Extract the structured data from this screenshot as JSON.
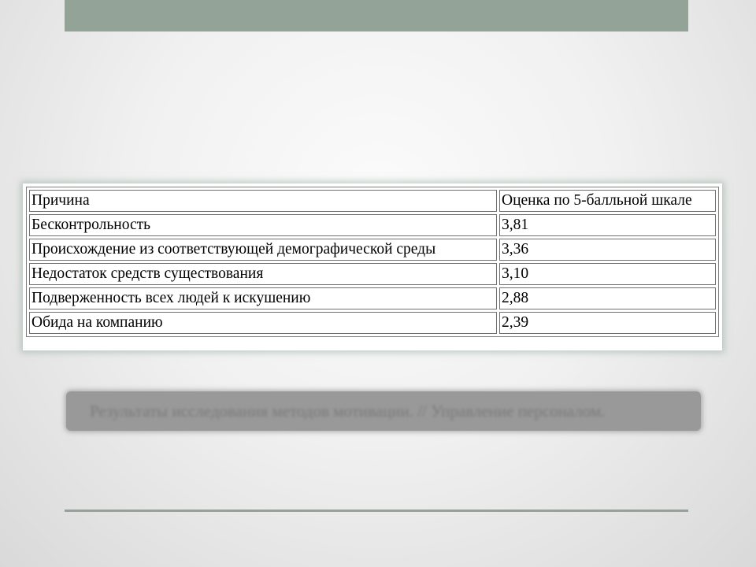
{
  "slide": {
    "table": {
      "header": {
        "reason": "Причина",
        "score": "Оценка по 5-балльной шкале"
      },
      "rows": [
        {
          "reason": "Бесконтрольность",
          "score": "3,81"
        },
        {
          "reason": "Происхождение из соответствующей демографической среды",
          "score": "3,36"
        },
        {
          "reason": "Недостаток средств существования",
          "score": "3,10"
        },
        {
          "reason": "Подверженность всех людей к искушению",
          "score": "2,88"
        },
        {
          "reason": "Обида на компанию",
          "score": "2,39"
        }
      ]
    },
    "caption": "Результаты исследования методов мотивации. // Управление персоналом.",
    "colors": {
      "accent_bar": "#93a398",
      "caption_box": "#999999"
    }
  }
}
